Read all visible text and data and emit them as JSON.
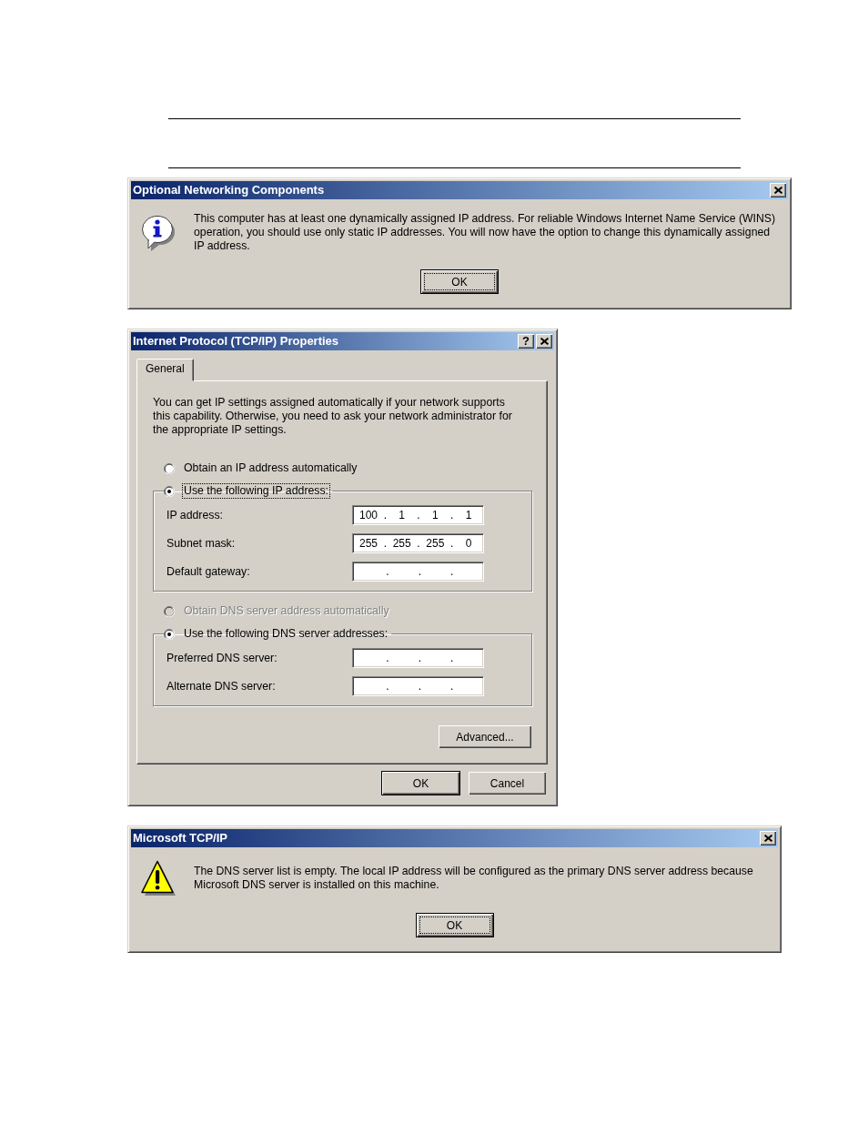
{
  "dialogs": [
    {
      "kind": "information",
      "title": "Optional Networking Components",
      "title_buttons": [
        {
          "kind": "close"
        }
      ],
      "message": "This computer has at least one dynamically assigned IP address. For reliable Windows Internet Name Service (WINS) operation, you should use only static IP addresses. You will now have the option to change this dynamically assigned IP address.",
      "buttons": [
        {
          "label": "OK",
          "default": true,
          "focused": true
        }
      ]
    },
    {
      "kind": "properties",
      "title": "Internet Protocol (TCP/IP) Properties",
      "title_buttons": [
        {
          "kind": "help",
          "label": "?"
        },
        {
          "kind": "close"
        }
      ],
      "tabs": [
        {
          "label": "General",
          "selected": true
        }
      ],
      "intro": "You can get IP settings assigned automatically if your network supports this capability. Otherwise, you need to ask your network administrator for the appropriate IP settings.",
      "ip_settings": {
        "options": [
          {
            "label": "Obtain an IP address automatically",
            "selected": false,
            "disabled": false,
            "focused": false
          },
          {
            "label": "Use the following IP address:",
            "selected": true,
            "disabled": false,
            "focused": true
          }
        ],
        "fields": [
          {
            "label": "IP address:",
            "value": "100 . 1 . 1 . 1"
          },
          {
            "label": "Subnet mask:",
            "value": "255 . 255 . 255 . 0"
          },
          {
            "label": "Default gateway:",
            "value": ". . ."
          }
        ]
      },
      "dns_settings": {
        "options": [
          {
            "label": "Obtain DNS server address automatically",
            "selected": false,
            "disabled": true,
            "focused": false
          },
          {
            "label": "Use the following DNS server addresses:",
            "selected": true,
            "disabled": false,
            "focused": false
          }
        ],
        "fields": [
          {
            "label": "Preferred DNS server:",
            "value": ". . ."
          },
          {
            "label": "Alternate DNS server:",
            "value": ". . ."
          }
        ]
      },
      "advanced_button": {
        "label": "Advanced...",
        "default": false,
        "focused": false
      },
      "buttons": [
        {
          "label": "OK",
          "default": true,
          "focused": false
        },
        {
          "label": "Cancel",
          "default": false,
          "focused": false
        }
      ]
    },
    {
      "kind": "warning",
      "title": "Microsoft TCP/IP",
      "title_buttons": [
        {
          "kind": "close"
        }
      ],
      "message": "The DNS server list is empty. The local IP address will be configured as the primary DNS server address because Microsoft DNS server is installed on this machine.",
      "buttons": [
        {
          "label": "OK",
          "default": true,
          "focused": true
        }
      ]
    }
  ]
}
